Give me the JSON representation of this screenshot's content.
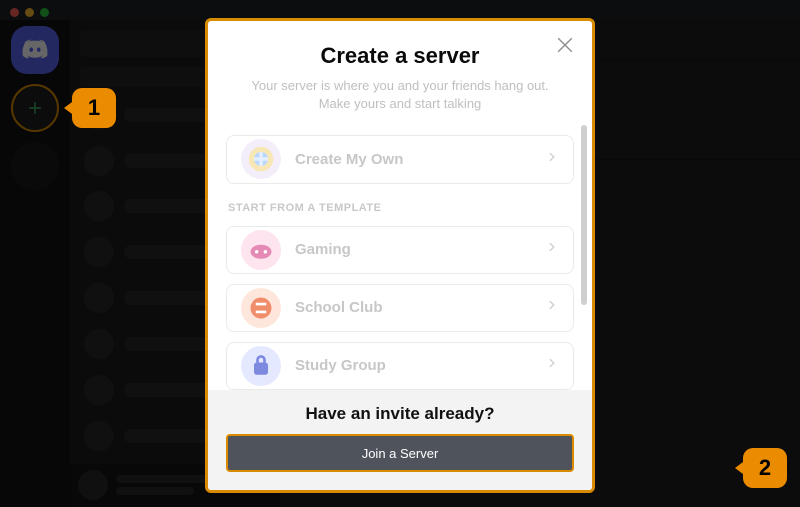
{
  "annotations": {
    "step1": "1",
    "step2": "2"
  },
  "modal": {
    "title": "Create a server",
    "subtitle": "Your server is where you and your friends hang out. Make yours and start talking",
    "option_create": "Create My Own",
    "template_header": "START FROM A TEMPLATE",
    "option_gaming": "Gaming",
    "option_school": "School Club",
    "option_study": "Study Group",
    "invite_title": "Have an invite already?",
    "join_button": "Join a Server"
  }
}
